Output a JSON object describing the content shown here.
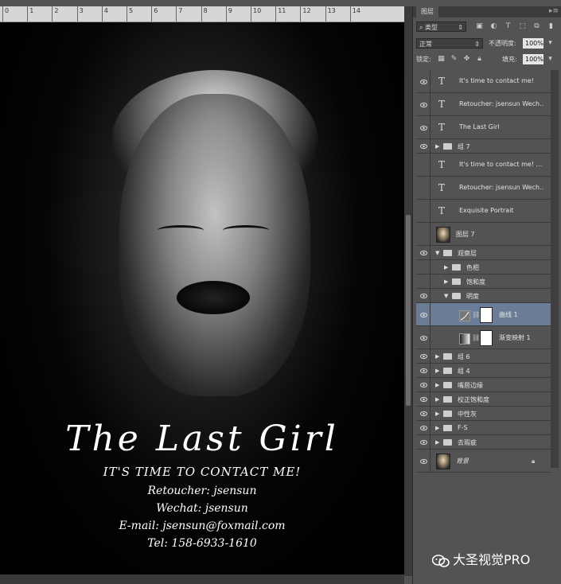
{
  "ruler": {
    "ticks": [
      "0",
      "1",
      "2",
      "3",
      "4",
      "5",
      "6",
      "7",
      "8",
      "9",
      "10",
      "11",
      "12",
      "13",
      "14"
    ]
  },
  "poster": {
    "title": "The Last Girl",
    "tagline": "IT'S TIME TO CONTACT ME!",
    "line1": "Retoucher: jsensun",
    "line2": "Wechat: jsensun",
    "line3": "E-mail:   jsensun@foxmail.com",
    "line4": "Tel: 158-6933-1610"
  },
  "panel": {
    "tab": "图层",
    "filter_kind": "类型",
    "blend_mode": "正常",
    "opacity_label": "不透明度:",
    "opacity_value": "100%",
    "lock_label": "锁定:",
    "fill_label": "填充:",
    "fill_value": "100%"
  },
  "layers": [
    {
      "name": "It's time to contact me!",
      "kind": "text",
      "visible": true,
      "indent": 0
    },
    {
      "name": "Retoucher: jsensun Wech...",
      "kind": "text",
      "visible": true,
      "indent": 0
    },
    {
      "name": "The Last Girl",
      "kind": "text",
      "visible": true,
      "indent": 0
    },
    {
      "name": "组 7",
      "kind": "group",
      "visible": true,
      "indent": 0,
      "expanded": false
    },
    {
      "name": "It's time to contact me! ...",
      "kind": "text",
      "visible": false,
      "indent": 0
    },
    {
      "name": "Retoucher: jsensun Wech...",
      "kind": "text",
      "visible": false,
      "indent": 0
    },
    {
      "name": "Exquisite Portrait",
      "kind": "text",
      "visible": false,
      "indent": 0
    },
    {
      "name": "图层 7",
      "kind": "image",
      "visible": false,
      "indent": 0
    },
    {
      "name": "观察层",
      "kind": "group",
      "visible": true,
      "indent": 0,
      "expanded": true
    },
    {
      "name": "色相",
      "kind": "group",
      "visible": false,
      "indent": 1,
      "expanded": false
    },
    {
      "name": "饱和度",
      "kind": "group",
      "visible": false,
      "indent": 1,
      "expanded": false
    },
    {
      "name": "明度",
      "kind": "group",
      "visible": true,
      "indent": 1,
      "expanded": true
    },
    {
      "name": "曲线 1",
      "kind": "adjust-curves",
      "visible": true,
      "indent": 2,
      "selected": true
    },
    {
      "name": "渐变映射 1",
      "kind": "adjust-gradient",
      "visible": true,
      "indent": 2
    },
    {
      "name": "组 6",
      "kind": "group",
      "visible": true,
      "indent": 0,
      "expanded": false
    },
    {
      "name": "组 4",
      "kind": "group",
      "visible": true,
      "indent": 0,
      "expanded": false
    },
    {
      "name": "嘴唇边缘",
      "kind": "group",
      "visible": true,
      "indent": 0,
      "expanded": false
    },
    {
      "name": "校正饱和度",
      "kind": "group",
      "visible": true,
      "indent": 0,
      "expanded": false
    },
    {
      "name": "中性灰",
      "kind": "group",
      "visible": true,
      "indent": 0,
      "expanded": false
    },
    {
      "name": "F-S",
      "kind": "group",
      "visible": true,
      "indent": 0,
      "expanded": false
    },
    {
      "name": "去瑕疵",
      "kind": "group",
      "visible": true,
      "indent": 0,
      "expanded": false
    },
    {
      "name": "背景",
      "kind": "background",
      "visible": true,
      "indent": 0,
      "locked": true
    }
  ],
  "watermark": "大圣视觉PRO"
}
